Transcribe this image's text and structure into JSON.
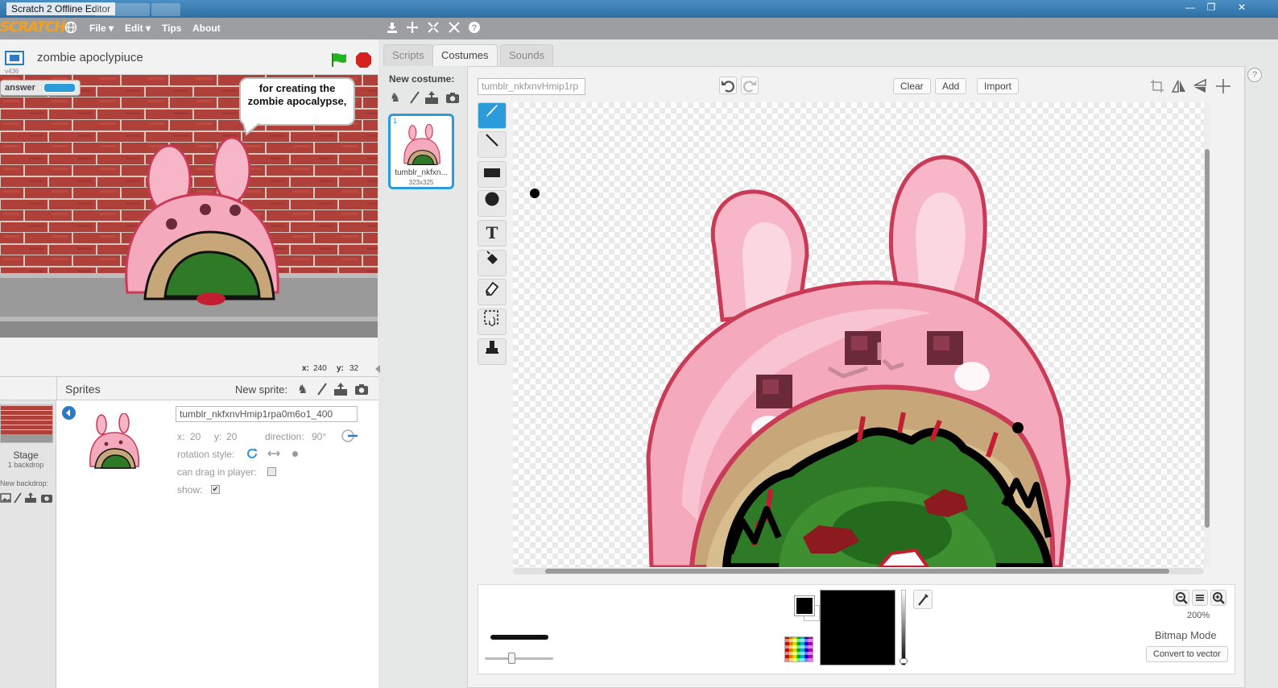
{
  "window": {
    "title": "Scratch 2 Offline Editor",
    "controls": [
      "—",
      "❐",
      "✕"
    ]
  },
  "menubar": {
    "logo": "SCRATCH",
    "items": [
      {
        "label": "File ▾"
      },
      {
        "label": "Edit ▾"
      },
      {
        "label": "Tips"
      },
      {
        "label": "About"
      }
    ],
    "tool_icons": [
      "duplicate-icon",
      "delete-cut-icon",
      "grow-icon",
      "shrink-icon",
      "help-icon"
    ]
  },
  "stage": {
    "project_name": "zombie apoclypiuce",
    "version": "v436",
    "monitor_label": "answer",
    "speech_bubble": "for creating the zombie apocalypse,",
    "coord_x_label": "x:",
    "coord_x": "240",
    "coord_y_label": "y:",
    "coord_y": "32",
    "colors": {
      "brick": "#b0403a",
      "mortar": "#d9c9c5",
      "ground": "#8e8e8e",
      "flag": "#22b422",
      "stop": "#d4231f"
    }
  },
  "sprites": {
    "title": "Sprites",
    "new_sprite_label": "New sprite:",
    "stage_label": "Stage",
    "stage_sub": "1 backdrop",
    "new_backdrop_label": "New backdrop:",
    "sprite_name": "tumblr_nkfxnvHmip1rpa0m6o1_400",
    "x_label": "x:",
    "x_value": "20",
    "y_label": "y:",
    "y_value": "20",
    "direction_label": "direction:",
    "direction_value": "90°",
    "rotation_label": "rotation style:",
    "drag_label": "can drag in player:",
    "show_label": "show:",
    "show_checked": "✔"
  },
  "editor": {
    "tabs": [
      {
        "label": "Scripts",
        "active": false
      },
      {
        "label": "Costumes",
        "active": true
      },
      {
        "label": "Sounds",
        "active": false
      }
    ],
    "new_costume_label": "New costume:",
    "costume": {
      "index": "1",
      "name": "tumblr_nkfxn...",
      "size": "323x325"
    },
    "costume_name_field": "tumblr_nkfxnvHmip1rp",
    "buttons": {
      "clear": "Clear",
      "add": "Add",
      "import": "Import"
    },
    "tools": [
      "brush-tool",
      "line-tool",
      "rectangle-tool",
      "ellipse-tool",
      "text-tool",
      "fill-tool",
      "eraser-tool",
      "select-tool",
      "stamp-tool"
    ],
    "zoom": "200%",
    "mode": "Bitmap Mode",
    "convert_button": "Convert to vector",
    "primary_color": "#000000",
    "secondary_color": "#ffffff"
  }
}
